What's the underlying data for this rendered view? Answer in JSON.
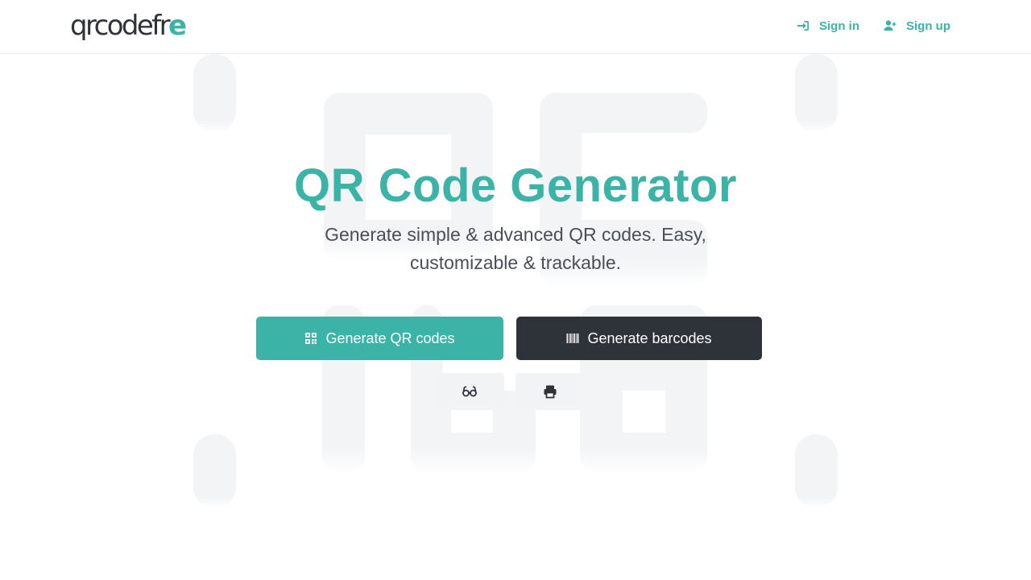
{
  "header": {
    "logo": {
      "main": "qrcodefr",
      "accent": "e"
    },
    "nav": [
      {
        "label": "Sign in",
        "icon": "sign-in-icon"
      },
      {
        "label": "Sign up",
        "icon": "user-plus-icon"
      }
    ]
  },
  "hero": {
    "title": "QR Code Generator",
    "subtitle": "Generate simple & advanced QR codes. Easy, customizable & trackable."
  },
  "actions": {
    "qr_button": {
      "label": "Generate QR codes",
      "icon": "qrcode-icon"
    },
    "barcode_button": {
      "label": "Generate barcodes",
      "icon": "barcode-icon"
    },
    "secondary": [
      {
        "icon": "glasses-icon"
      },
      {
        "icon": "print-icon"
      }
    ]
  },
  "colors": {
    "accent": "#3bb3a7",
    "dark": "#2e3239",
    "text": "#4a4f57"
  }
}
